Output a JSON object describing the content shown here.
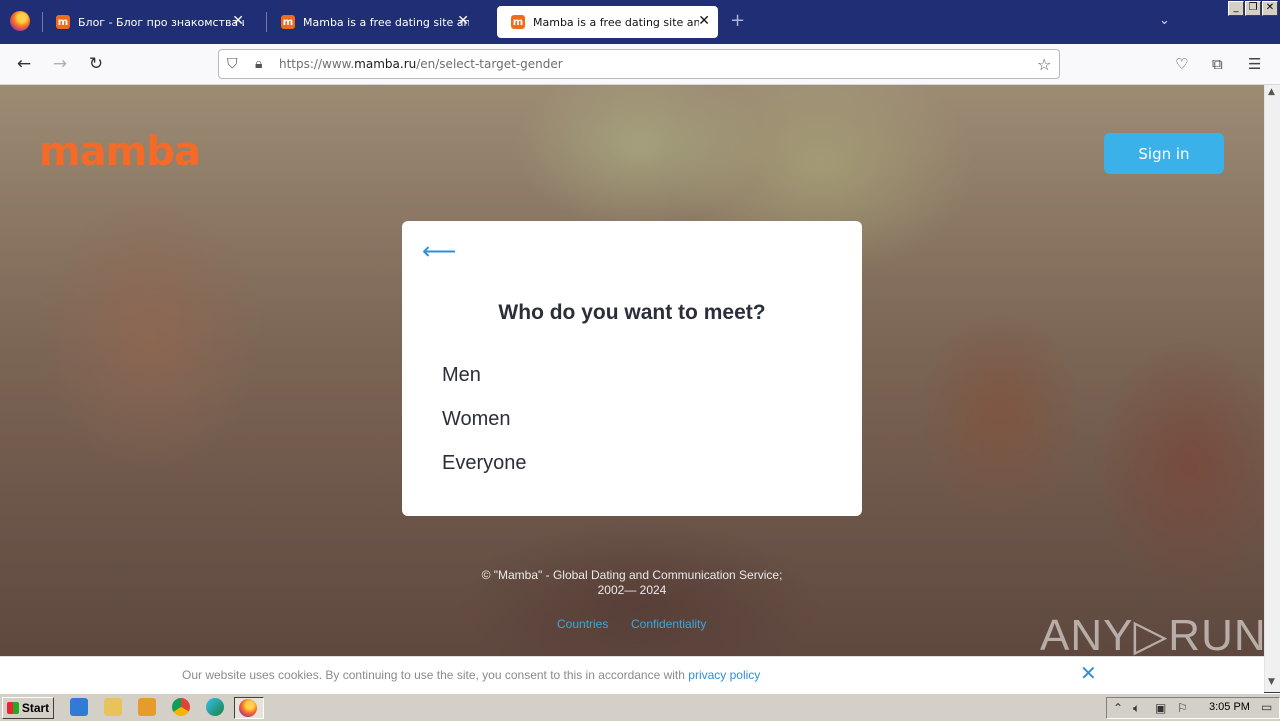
{
  "browser": {
    "tabs": [
      {
        "title": "Блог - Блог про знакомства и отношения",
        "favicon": "m",
        "active": false
      },
      {
        "title": "Mamba is a free dating site and a chat",
        "favicon": "m",
        "active": false
      },
      {
        "title": "Mamba is a free dating site and a chat",
        "favicon": "m",
        "active": true
      }
    ],
    "new_tab_icon": "+",
    "url_prefix": "https://www.",
    "url_domain": "mamba.ru",
    "url_path": "/en/select-target-gender"
  },
  "page": {
    "logo": "mamba",
    "signin_label": "Sign in",
    "question": "Who do you want to meet?",
    "options": [
      "Men",
      "Women",
      "Everyone"
    ],
    "copyright_line1": "© \"Mamba\" - Global Dating and Communication Service;",
    "copyright_line2": "2002— 2024",
    "footer_links": {
      "countries": "Countries",
      "confidentiality": "Confidentiality"
    },
    "watermark": "ANY▷RUN"
  },
  "cookie": {
    "text": "Our website uses cookies. By continuing to use the site, you consent to this in accordance with ",
    "link": "privacy policy"
  },
  "taskbar": {
    "start_label": "Start",
    "clock": "3:05 PM"
  },
  "colors": {
    "brand_orange": "#f46a27",
    "accent_blue": "#3bb1ea",
    "tab_strip": "#1f2e75"
  }
}
